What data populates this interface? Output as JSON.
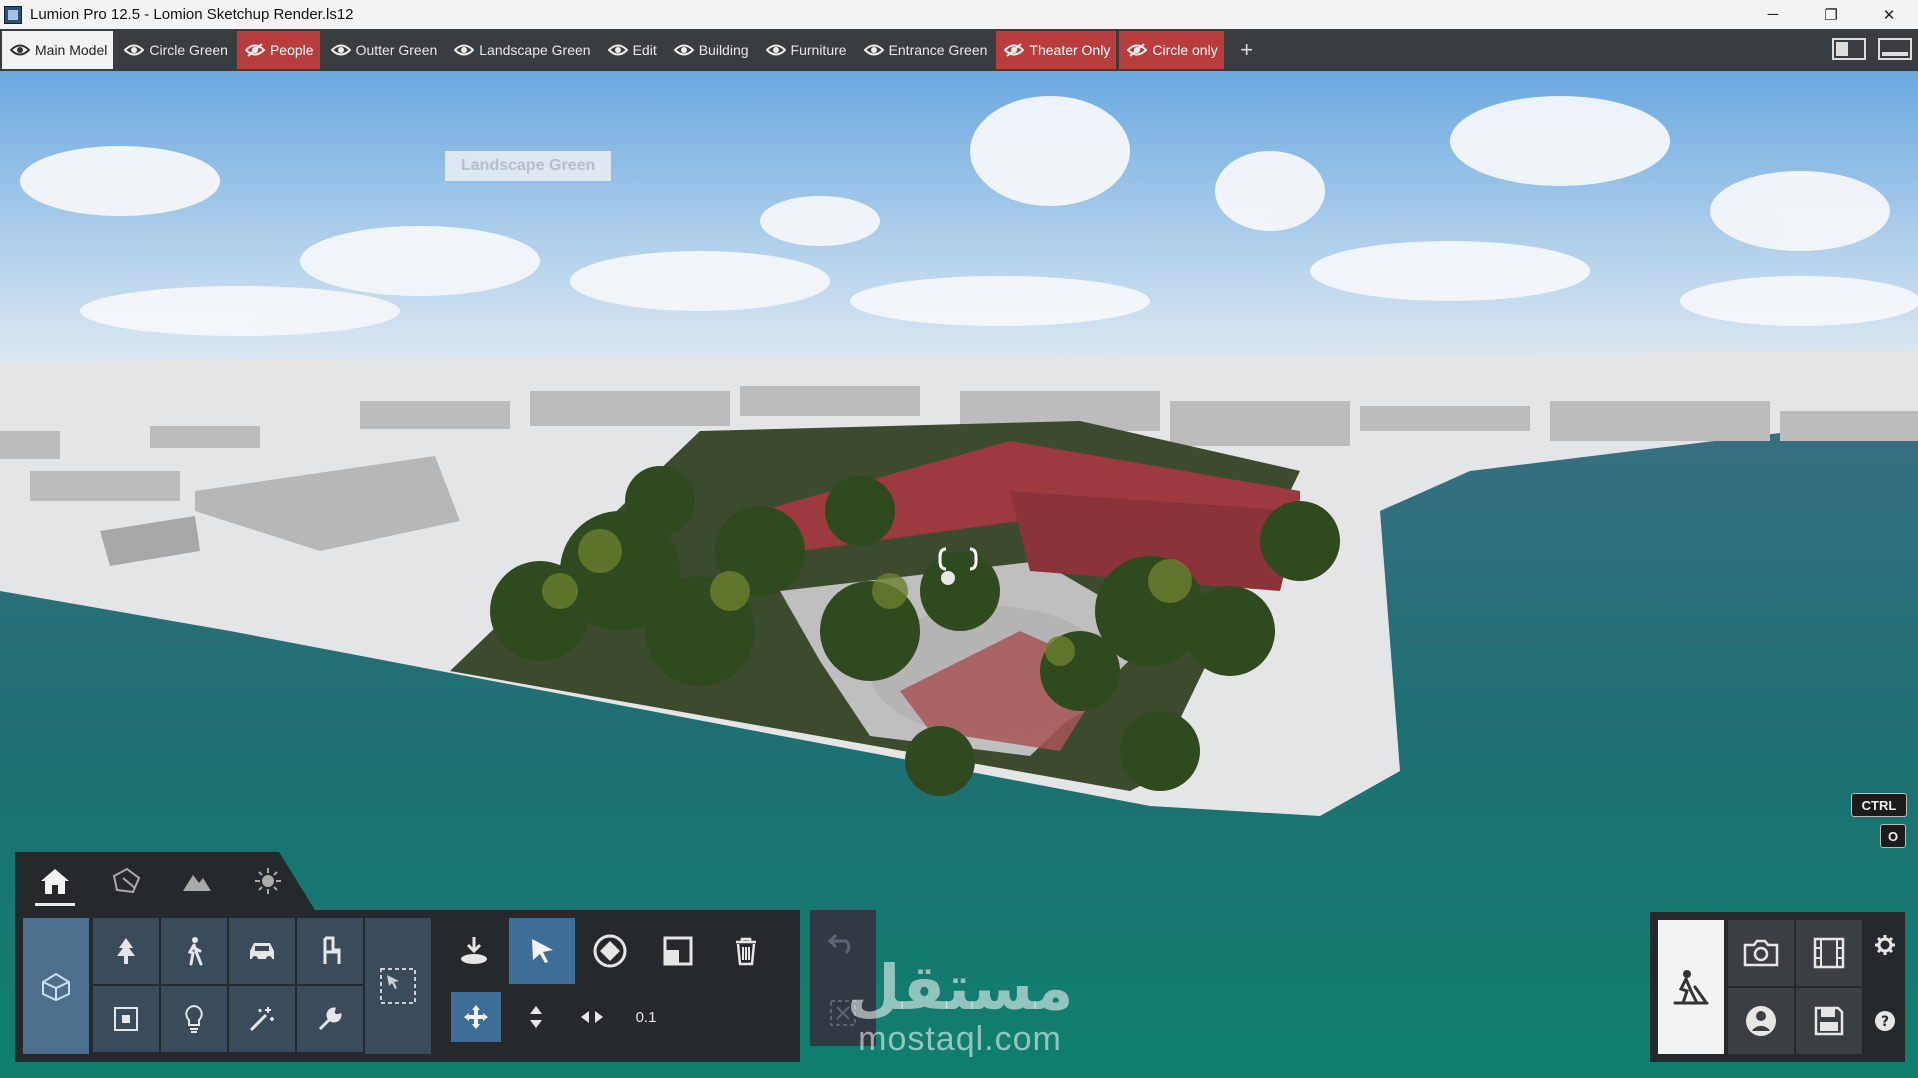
{
  "window": {
    "title": "Lumion Pro 12.5 - Lomion Sketchup Render.ls12",
    "controls": {
      "minimize": "─",
      "restore": "❐",
      "close": "✕"
    }
  },
  "layers": [
    {
      "label": "Main Model",
      "state": "active"
    },
    {
      "label": "Circle Green",
      "state": "visible"
    },
    {
      "label": "People",
      "state": "hidden"
    },
    {
      "label": "Outter Green",
      "state": "visible"
    },
    {
      "label": "Landscape Green",
      "state": "visible"
    },
    {
      "label": "Edit",
      "state": "visible"
    },
    {
      "label": "Building",
      "state": "visible"
    },
    {
      "label": "Furniture",
      "state": "visible"
    },
    {
      "label": "Entrance Green",
      "state": "visible"
    },
    {
      "label": "Theater Only",
      "state": "hidden"
    },
    {
      "label": "Circle only",
      "state": "hidden"
    }
  ],
  "add_layer": "+",
  "tooltip": "Landscape Green",
  "key_hints": {
    "ctrl": "CTRL",
    "o": "O"
  },
  "tool_panel": {
    "tabs": [
      "home-icon",
      "material-icon",
      "landscape-icon",
      "weather-icon"
    ],
    "category_icons": [
      "nature-icon",
      "people-icon",
      "transport-icon",
      "furniture-icon",
      "sound-icon",
      "light-icon",
      "effects-icon",
      "utilities-icon"
    ],
    "transform_value": "0.1"
  },
  "modes": [
    "build-mode-icon",
    "photo-mode-icon",
    "movie-mode-icon",
    "panorama-mode-icon",
    "save-icon",
    "settings-icon",
    "help-icon"
  ],
  "watermark": {
    "arabic": "مستقل",
    "latin": "mostaql.com"
  },
  "colors": {
    "hidden_layer": "#b93d3d",
    "panel": "#26292c",
    "selected_tool": "#3e6e97"
  }
}
